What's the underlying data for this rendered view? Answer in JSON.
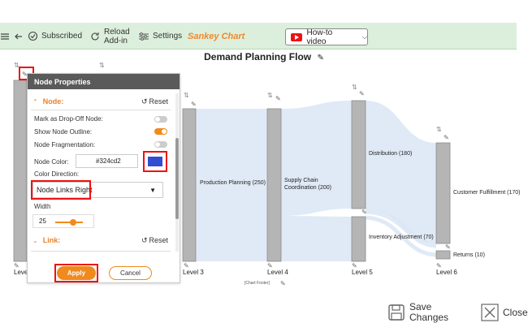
{
  "toolbar": {
    "subscribed": "Subscribed",
    "reload_line1": "Reload",
    "reload_line2": "Add-in",
    "settings": "Settings",
    "brand": "Sankey Chart",
    "howto": "How-to video"
  },
  "chart": {
    "title": "Demand Planning Flow",
    "footer": "[Chart Footer]",
    "levels": [
      "Level 3",
      "Level 4",
      "Level 5",
      "Level 6"
    ],
    "level_partial": "Leve",
    "nodes": {
      "production": "Production Planning (250)",
      "supply_line1": "Supply Chain",
      "supply_line2": "Coordination (200)",
      "distribution": "Distribution (180)",
      "inventory": "Inventory Adjustment (70)",
      "customer": "Customer Fulfillment (170)",
      "returns": "Returns (10)"
    }
  },
  "panel": {
    "title": "Node Properties",
    "node_section": "Node:",
    "link_section": "Link:",
    "reset": "Reset",
    "drop_off": "Mark as Drop-Off Node:",
    "outline": "Show Node Outline:",
    "fragmentation": "Node Fragmentation:",
    "color_label": "Node Color:",
    "color_value": "#324cd2",
    "direction_label": "Color Direction:",
    "direction_value": "Node Links Right",
    "width_label": "Width",
    "width_value": "25",
    "apply": "Apply",
    "cancel": "Cancel"
  },
  "actions": {
    "save_line1": "Save",
    "save_line2": "Changes",
    "close": "Close"
  },
  "colors": {
    "accent": "#f08a1c",
    "node_color": "#324cd2",
    "toolbar_bg": "#dcefdc"
  }
}
